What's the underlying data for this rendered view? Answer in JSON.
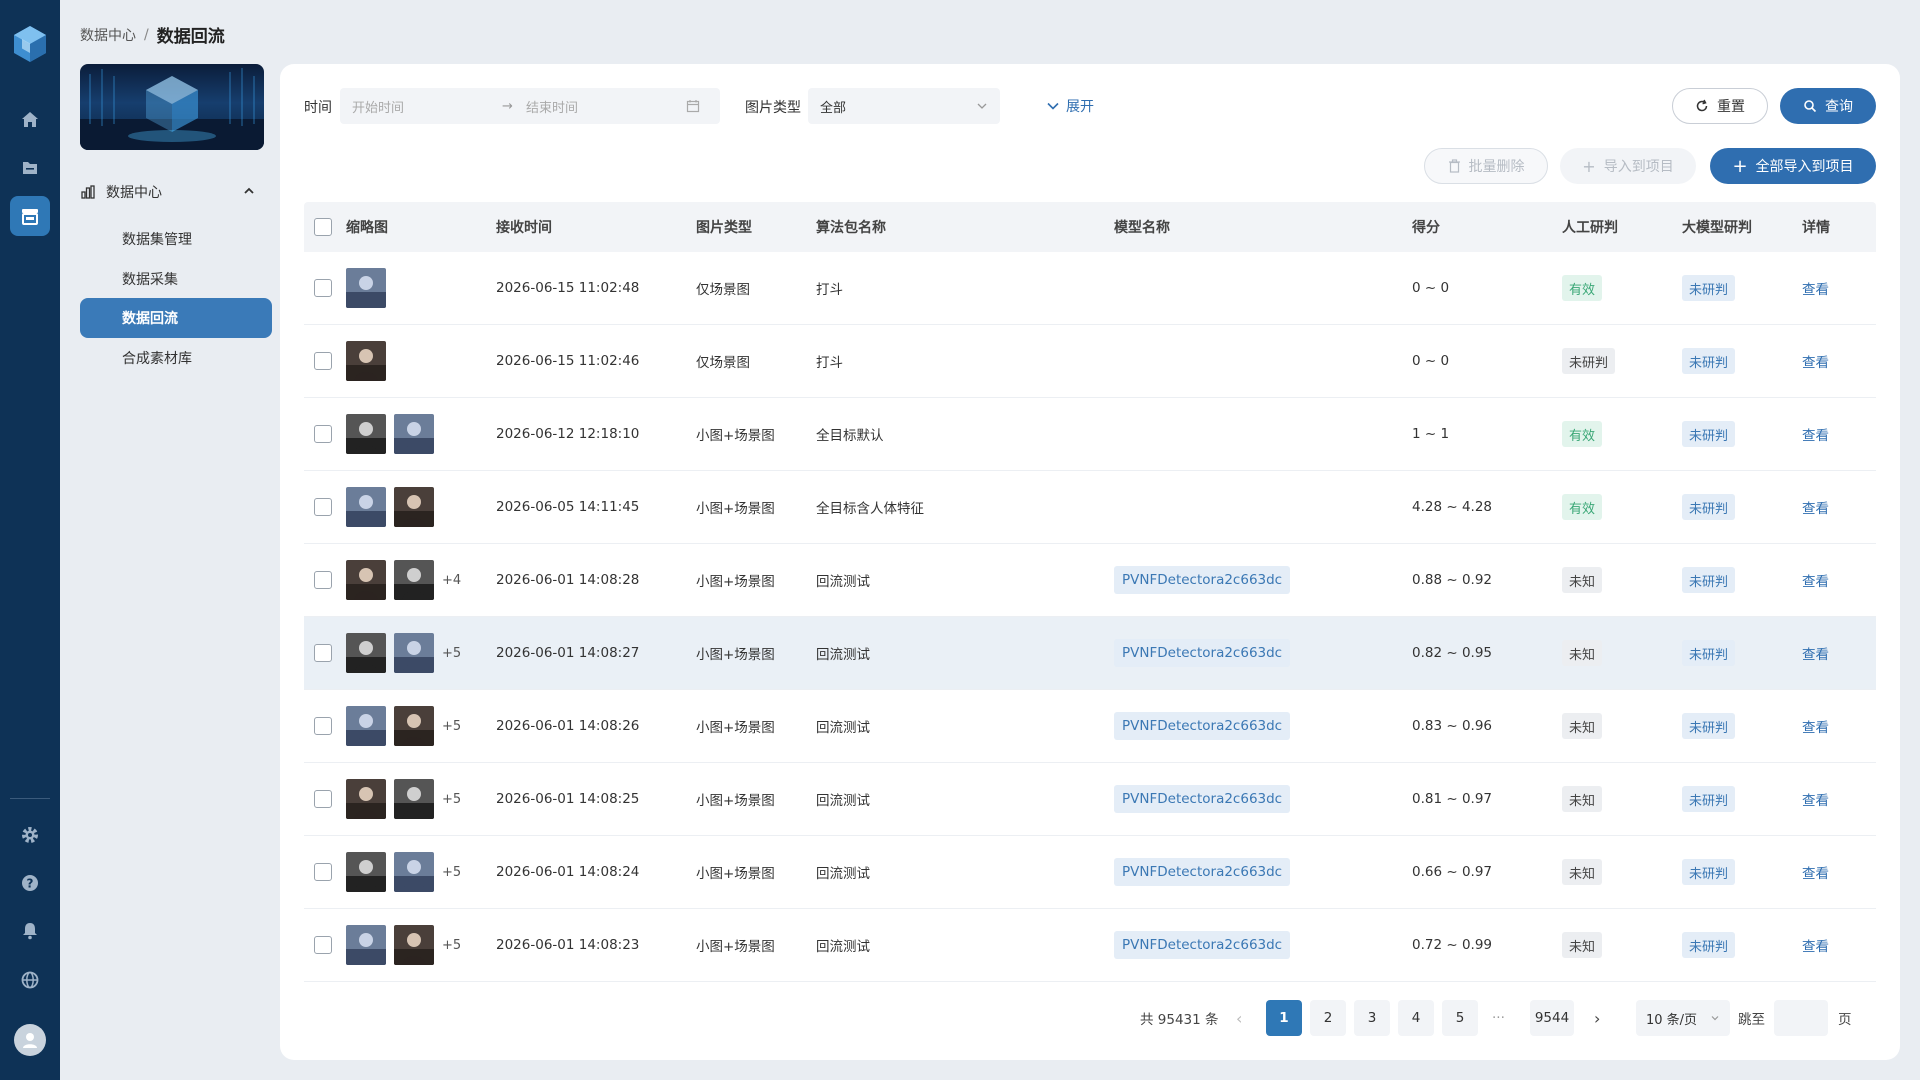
{
  "breadcrumb": {
    "parent": "数据中心",
    "sep": "/",
    "current": "数据回流"
  },
  "sidebar": {
    "group_label": "数据中心",
    "items": [
      {
        "label": "数据集管理"
      },
      {
        "label": "数据采集"
      },
      {
        "label": "数据回流",
        "active": true
      },
      {
        "label": "合成素材库"
      }
    ]
  },
  "filters": {
    "time_label": "时间",
    "start_placeholder": "开始时间",
    "end_placeholder": "结束时间",
    "range_arrow": "→",
    "type_label": "图片类型",
    "type_value": "全部",
    "expand_label": "展开"
  },
  "actions": {
    "reset": "重置",
    "query": "查询",
    "batch_delete": "批量删除",
    "import_to_project": "导入到项目",
    "import_all": "全部导入到项目"
  },
  "table": {
    "headers": [
      "缩略图",
      "接收时间",
      "图片类型",
      "算法包名称",
      "模型名称",
      "得分",
      "人工研判",
      "大模型研判",
      "详情"
    ],
    "rows": [
      {
        "thumbs": 1,
        "extra": "",
        "time": "2026-06-15 11:02:48",
        "type": "仅场景图",
        "algo": "打斗",
        "model": "",
        "score": "0 ~ 0",
        "manual": "有效",
        "manual_style": "green",
        "llm": "未研判",
        "detail": "查看"
      },
      {
        "thumbs": 1,
        "extra": "",
        "time": "2026-06-15 11:02:46",
        "type": "仅场景图",
        "algo": "打斗",
        "model": "",
        "score": "0 ~ 0",
        "manual": "未研判",
        "manual_style": "gray",
        "llm": "未研判",
        "detail": "查看"
      },
      {
        "thumbs": 2,
        "extra": "",
        "time": "2026-06-12 12:18:10",
        "type": "小图+场景图",
        "algo": "全目标默认",
        "model": "",
        "score": "1 ~ 1",
        "manual": "有效",
        "manual_style": "green",
        "llm": "未研判",
        "detail": "查看"
      },
      {
        "thumbs": 2,
        "extra": "",
        "time": "2026-06-05 14:11:45",
        "type": "小图+场景图",
        "algo": "全目标含人体特征",
        "model": "",
        "score": "4.28 ~ 4.28",
        "manual": "有效",
        "manual_style": "green",
        "llm": "未研判",
        "detail": "查看"
      },
      {
        "thumbs": 2,
        "extra": "+4",
        "time": "2026-06-01 14:08:28",
        "type": "小图+场景图",
        "algo": "回流测试",
        "model": "PVNFDetectora2c663dc",
        "score": "0.88 ~ 0.92",
        "manual": "未知",
        "manual_style": "gray",
        "llm": "未研判",
        "detail": "查看"
      },
      {
        "thumbs": 2,
        "extra": "+5",
        "time": "2026-06-01 14:08:27",
        "type": "小图+场景图",
        "algo": "回流测试",
        "model": "PVNFDetectora2c663dc",
        "score": "0.82 ~ 0.95",
        "manual": "未知",
        "manual_style": "gray",
        "llm": "未研判",
        "detail": "查看"
      },
      {
        "thumbs": 2,
        "extra": "+5",
        "time": "2026-06-01 14:08:26",
        "type": "小图+场景图",
        "algo": "回流测试",
        "model": "PVNFDetectora2c663dc",
        "score": "0.83 ~ 0.96",
        "manual": "未知",
        "manual_style": "gray",
        "llm": "未研判",
        "detail": "查看"
      },
      {
        "thumbs": 2,
        "extra": "+5",
        "time": "2026-06-01 14:08:25",
        "type": "小图+场景图",
        "algo": "回流测试",
        "model": "PVNFDetectora2c663dc",
        "score": "0.81 ~ 0.97",
        "manual": "未知",
        "manual_style": "gray",
        "llm": "未研判",
        "detail": "查看"
      },
      {
        "thumbs": 2,
        "extra": "+5",
        "time": "2026-06-01 14:08:24",
        "type": "小图+场景图",
        "algo": "回流测试",
        "model": "PVNFDetectora2c663dc",
        "score": "0.66 ~ 0.97",
        "manual": "未知",
        "manual_style": "gray",
        "llm": "未研判",
        "detail": "查看"
      },
      {
        "thumbs": 2,
        "extra": "+5",
        "time": "2026-06-01 14:08:23",
        "type": "小图+场景图",
        "algo": "回流测试",
        "model": "PVNFDetectora2c663dc",
        "score": "0.72 ~ 0.99",
        "manual": "未知",
        "manual_style": "gray",
        "llm": "未研判",
        "detail": "查看"
      }
    ]
  },
  "pagination": {
    "total": "共 95431 条",
    "pages": [
      "1",
      "2",
      "3",
      "4",
      "5"
    ],
    "ellipsis": "···",
    "last": "9544",
    "page_size": "10 条/页",
    "jump_label": "跳至",
    "page_unit": "页"
  },
  "colors": {
    "rail": "#0e3256",
    "accent": "#2f6eb0",
    "active": "#3a7ab8"
  }
}
